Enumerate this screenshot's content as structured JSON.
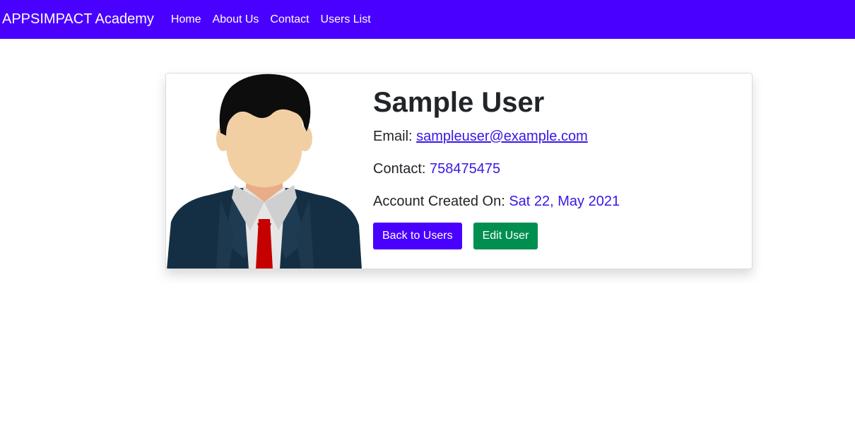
{
  "navbar": {
    "brand": "APPSIMPACT Academy",
    "links": [
      "Home",
      "About Us",
      "Contact",
      "Users List"
    ],
    "color": "#4a00ff"
  },
  "user": {
    "avatar_icon": "user-avatar-icon",
    "name": "Sample User",
    "email_label": "Email: ",
    "email": "sampleuser@example.com",
    "contact_label": "Contact: ",
    "contact": "758475475",
    "created_label": "Account Created On: ",
    "created": "Sat 22, May 2021"
  },
  "actions": {
    "back_label": "Back to Users",
    "edit_label": "Edit User"
  },
  "colors": {
    "primary": "#4a00ff",
    "success": "#008f4f",
    "link": "#3a16e6"
  }
}
